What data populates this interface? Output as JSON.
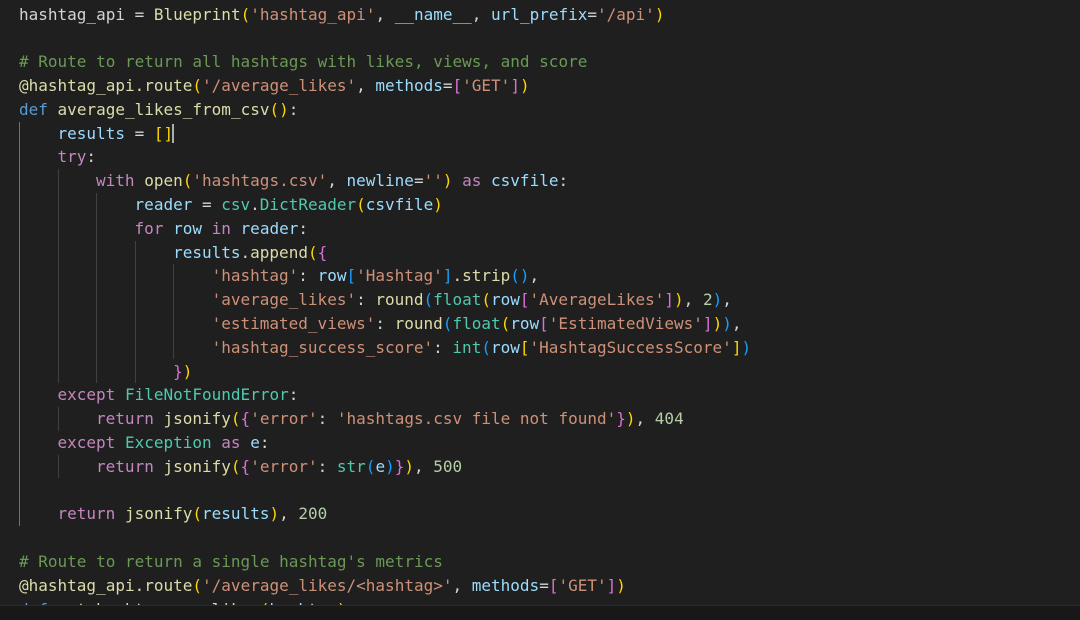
{
  "editor": {
    "language": "python",
    "colors": {
      "background": "#1f1f1f",
      "default": "#cccccc",
      "plain": "#d4d4d4",
      "keyword": "#569cd6",
      "control": "#c586c0",
      "string": "#ce9178",
      "comment": "#6a9955",
      "function": "#dcdcaa",
      "variable": "#9cdcfe",
      "class": "#4ec9b0",
      "number": "#b5cea8",
      "bracket1": "#ffd700",
      "bracket2": "#da70d6",
      "bracket3": "#179fff",
      "cursor": "#aeafad",
      "indent_guide": "#404040"
    },
    "lines": [
      {
        "indent": 0,
        "tokens": [
          [
            "hashtag_api",
            "plain"
          ],
          [
            " = ",
            "plain"
          ],
          [
            "Blueprint",
            "function"
          ],
          [
            "(",
            "bracket1"
          ],
          [
            "'hashtag_api'",
            "string"
          ],
          [
            ", ",
            "plain"
          ],
          [
            "__name__",
            "variable"
          ],
          [
            ", ",
            "plain"
          ],
          [
            "url_prefix",
            "variable"
          ],
          [
            "=",
            "plain"
          ],
          [
            "'/api'",
            "string"
          ],
          [
            ")",
            "bracket1"
          ]
        ]
      },
      {
        "indent": 0,
        "tokens": []
      },
      {
        "indent": 0,
        "tokens": [
          [
            "# Route to return all hashtags with likes, views, and score",
            "comment"
          ]
        ]
      },
      {
        "indent": 0,
        "tokens": [
          [
            "@hashtag_api.route",
            "function"
          ],
          [
            "(",
            "bracket1"
          ],
          [
            "'/average_likes'",
            "string"
          ],
          [
            ", ",
            "plain"
          ],
          [
            "methods",
            "variable"
          ],
          [
            "=",
            "plain"
          ],
          [
            "[",
            "bracket2"
          ],
          [
            "'GET'",
            "string"
          ],
          [
            "]",
            "bracket2"
          ],
          [
            ")",
            "bracket1"
          ]
        ]
      },
      {
        "indent": 0,
        "tokens": [
          [
            "def",
            "keyword"
          ],
          [
            " ",
            "plain"
          ],
          [
            "average_likes_from_csv",
            "function"
          ],
          [
            "(",
            "bracket1"
          ],
          [
            ")",
            "bracket1"
          ],
          [
            ":",
            "plain"
          ]
        ]
      },
      {
        "indent": 1,
        "tokens": [
          [
            "results",
            "variable"
          ],
          [
            " = ",
            "plain"
          ],
          [
            "[",
            "bracket1"
          ],
          [
            "]",
            "bracket1"
          ]
        ],
        "cursor_after": 3
      },
      {
        "indent": 1,
        "tokens": [
          [
            "try",
            "control"
          ],
          [
            ":",
            "plain"
          ]
        ]
      },
      {
        "indent": 2,
        "tokens": [
          [
            "with",
            "control"
          ],
          [
            " ",
            "plain"
          ],
          [
            "open",
            "function"
          ],
          [
            "(",
            "bracket1"
          ],
          [
            "'hashtags.csv'",
            "string"
          ],
          [
            ", ",
            "plain"
          ],
          [
            "newline",
            "variable"
          ],
          [
            "=",
            "plain"
          ],
          [
            "''",
            "string"
          ],
          [
            ")",
            "bracket1"
          ],
          [
            " ",
            "plain"
          ],
          [
            "as",
            "control"
          ],
          [
            " ",
            "plain"
          ],
          [
            "csvfile",
            "variable"
          ],
          [
            ":",
            "plain"
          ]
        ]
      },
      {
        "indent": 3,
        "tokens": [
          [
            "reader",
            "variable"
          ],
          [
            " = ",
            "plain"
          ],
          [
            "csv",
            "class"
          ],
          [
            ".",
            "plain"
          ],
          [
            "DictReader",
            "class"
          ],
          [
            "(",
            "bracket1"
          ],
          [
            "csvfile",
            "variable"
          ],
          [
            ")",
            "bracket1"
          ]
        ]
      },
      {
        "indent": 3,
        "tokens": [
          [
            "for",
            "control"
          ],
          [
            " ",
            "plain"
          ],
          [
            "row",
            "variable"
          ],
          [
            " ",
            "plain"
          ],
          [
            "in",
            "control"
          ],
          [
            " ",
            "plain"
          ],
          [
            "reader",
            "variable"
          ],
          [
            ":",
            "plain"
          ]
        ]
      },
      {
        "indent": 4,
        "tokens": [
          [
            "results",
            "variable"
          ],
          [
            ".",
            "plain"
          ],
          [
            "append",
            "function"
          ],
          [
            "(",
            "bracket1"
          ],
          [
            "{",
            "bracket2"
          ]
        ]
      },
      {
        "indent": 5,
        "tokens": [
          [
            "'hashtag'",
            "string"
          ],
          [
            ": ",
            "plain"
          ],
          [
            "row",
            "variable"
          ],
          [
            "[",
            "bracket3"
          ],
          [
            "'Hashtag'",
            "string"
          ],
          [
            "]",
            "bracket3"
          ],
          [
            ".",
            "plain"
          ],
          [
            "strip",
            "function"
          ],
          [
            "(",
            "bracket3"
          ],
          [
            ")",
            "bracket3"
          ],
          [
            ",",
            "plain"
          ]
        ]
      },
      {
        "indent": 5,
        "tokens": [
          [
            "'average_likes'",
            "string"
          ],
          [
            ": ",
            "plain"
          ],
          [
            "round",
            "function"
          ],
          [
            "(",
            "bracket3"
          ],
          [
            "float",
            "class"
          ],
          [
            "(",
            "bracket1"
          ],
          [
            "row",
            "variable"
          ],
          [
            "[",
            "bracket2"
          ],
          [
            "'AverageLikes'",
            "string"
          ],
          [
            "]",
            "bracket2"
          ],
          [
            ")",
            "bracket1"
          ],
          [
            ", ",
            "plain"
          ],
          [
            "2",
            "number"
          ],
          [
            ")",
            "bracket3"
          ],
          [
            ",",
            "plain"
          ]
        ]
      },
      {
        "indent": 5,
        "tokens": [
          [
            "'estimated_views'",
            "string"
          ],
          [
            ": ",
            "plain"
          ],
          [
            "round",
            "function"
          ],
          [
            "(",
            "bracket3"
          ],
          [
            "float",
            "class"
          ],
          [
            "(",
            "bracket1"
          ],
          [
            "row",
            "variable"
          ],
          [
            "[",
            "bracket2"
          ],
          [
            "'EstimatedViews'",
            "string"
          ],
          [
            "]",
            "bracket2"
          ],
          [
            ")",
            "bracket1"
          ],
          [
            ")",
            "bracket3"
          ],
          [
            ",",
            "plain"
          ]
        ]
      },
      {
        "indent": 5,
        "tokens": [
          [
            "'hashtag_success_score'",
            "string"
          ],
          [
            ": ",
            "plain"
          ],
          [
            "int",
            "class"
          ],
          [
            "(",
            "bracket3"
          ],
          [
            "row",
            "variable"
          ],
          [
            "[",
            "bracket1"
          ],
          [
            "'HashtagSuccessScore'",
            "string"
          ],
          [
            "]",
            "bracket1"
          ],
          [
            ")",
            "bracket3"
          ]
        ]
      },
      {
        "indent": 4,
        "tokens": [
          [
            "}",
            "bracket2"
          ],
          [
            ")",
            "bracket1"
          ]
        ]
      },
      {
        "indent": 1,
        "tokens": [
          [
            "except",
            "control"
          ],
          [
            " ",
            "plain"
          ],
          [
            "FileNotFoundError",
            "class"
          ],
          [
            ":",
            "plain"
          ]
        ]
      },
      {
        "indent": 2,
        "tokens": [
          [
            "return",
            "control"
          ],
          [
            " ",
            "plain"
          ],
          [
            "jsonify",
            "function"
          ],
          [
            "(",
            "bracket1"
          ],
          [
            "{",
            "bracket2"
          ],
          [
            "'error'",
            "string"
          ],
          [
            ": ",
            "plain"
          ],
          [
            "'hashtags.csv file not found'",
            "string"
          ],
          [
            "}",
            "bracket2"
          ],
          [
            ")",
            "bracket1"
          ],
          [
            ", ",
            "plain"
          ],
          [
            "404",
            "number"
          ]
        ]
      },
      {
        "indent": 1,
        "tokens": [
          [
            "except",
            "control"
          ],
          [
            " ",
            "plain"
          ],
          [
            "Exception",
            "class"
          ],
          [
            " ",
            "plain"
          ],
          [
            "as",
            "control"
          ],
          [
            " ",
            "plain"
          ],
          [
            "e",
            "variable"
          ],
          [
            ":",
            "plain"
          ]
        ]
      },
      {
        "indent": 2,
        "tokens": [
          [
            "return",
            "control"
          ],
          [
            " ",
            "plain"
          ],
          [
            "jsonify",
            "function"
          ],
          [
            "(",
            "bracket1"
          ],
          [
            "{",
            "bracket2"
          ],
          [
            "'error'",
            "string"
          ],
          [
            ": ",
            "plain"
          ],
          [
            "str",
            "class"
          ],
          [
            "(",
            "bracket3"
          ],
          [
            "e",
            "variable"
          ],
          [
            ")",
            "bracket3"
          ],
          [
            "}",
            "bracket2"
          ],
          [
            ")",
            "bracket1"
          ],
          [
            ", ",
            "plain"
          ],
          [
            "500",
            "number"
          ]
        ]
      },
      {
        "indent": 0,
        "tokens": []
      },
      {
        "indent": 1,
        "tokens": [
          [
            "return",
            "control"
          ],
          [
            " ",
            "plain"
          ],
          [
            "jsonify",
            "function"
          ],
          [
            "(",
            "bracket1"
          ],
          [
            "results",
            "variable"
          ],
          [
            ")",
            "bracket1"
          ],
          [
            ", ",
            "plain"
          ],
          [
            "200",
            "number"
          ]
        ]
      },
      {
        "indent": 0,
        "tokens": []
      },
      {
        "indent": 0,
        "tokens": [
          [
            "# Route to return a single hashtag's metrics",
            "comment"
          ]
        ]
      },
      {
        "indent": 0,
        "tokens": [
          [
            "@hashtag_api.route",
            "function"
          ],
          [
            "(",
            "bracket1"
          ],
          [
            "'/average_likes/<hashtag>'",
            "string"
          ],
          [
            ", ",
            "plain"
          ],
          [
            "methods",
            "variable"
          ],
          [
            "=",
            "plain"
          ],
          [
            "[",
            "bracket2"
          ],
          [
            "'GET'",
            "string"
          ],
          [
            "]",
            "bracket2"
          ],
          [
            ")",
            "bracket1"
          ]
        ]
      },
      {
        "indent": 0,
        "tokens": [
          [
            "def",
            "keyword"
          ],
          [
            " ",
            "plain"
          ],
          [
            "get_hashtag_avg_likes",
            "function"
          ],
          [
            "(",
            "bracket1"
          ],
          [
            "hashtag",
            "variable"
          ],
          [
            ")",
            "bracket1"
          ],
          [
            ":",
            "plain"
          ]
        ]
      }
    ]
  }
}
